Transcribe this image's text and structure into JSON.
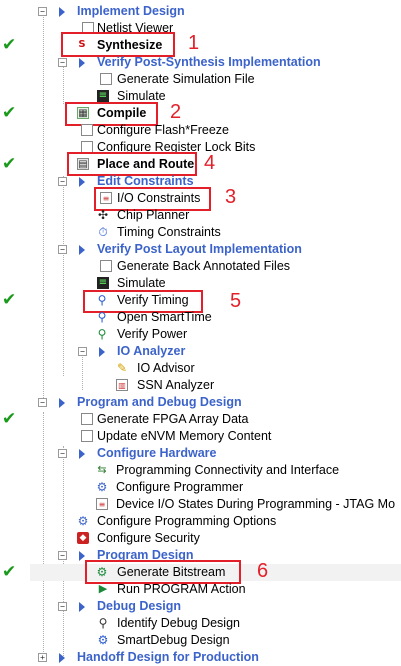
{
  "tree": {
    "implement_design": "Implement Design",
    "netlist_viewer": "Netlist Viewer",
    "synthesize": "Synthesize",
    "verify_post_synthesis": "Verify Post-Synthesis Implementation",
    "generate_simulation_file": "Generate Simulation File",
    "simulate_1": "Simulate",
    "compile": "Compile",
    "configure_flash_freeze": "Configure Flash*Freeze",
    "configure_register_lock_bits": "Configure Register Lock Bits",
    "place_and_route": "Place and Route",
    "edit_constraints": "Edit Constraints",
    "io_constraints": "I/O Constraints",
    "chip_planner": "Chip Planner",
    "timing_constraints": "Timing Constraints",
    "verify_post_layout": "Verify Post Layout Implementation",
    "generate_back_annotated": "Generate Back Annotated Files",
    "simulate_2": "Simulate",
    "verify_timing": "Verify Timing",
    "open_smarttime": "Open SmartTime",
    "verify_power": "Verify Power",
    "io_analyzer": "IO Analyzer",
    "io_advisor": "IO Advisor",
    "ssn_analyzer": "SSN Analyzer",
    "program_and_debug": "Program and Debug Design",
    "generate_fpga_array_data": "Generate FPGA Array Data",
    "update_envm": "Update eNVM Memory Content",
    "configure_hardware": "Configure Hardware",
    "programming_connectivity": "Programming Connectivity and Interface",
    "configure_programmer": "Configure Programmer",
    "device_io_states": "Device I/O States During Programming - JTAG Mo",
    "configure_programming_options": "Configure Programming Options",
    "configure_security": "Configure Security",
    "program_design": "Program Design",
    "generate_bitstream": "Generate Bitstream",
    "run_program_action": "Run PROGRAM Action",
    "debug_design": "Debug Design",
    "identify_debug_design": "Identify Debug Design",
    "smartdebug_design": "SmartDebug Design",
    "handoff_design": "Handoff Design for Production"
  },
  "annotations": {
    "n1": "1",
    "n2": "2",
    "n3": "3",
    "n4": "4",
    "n5": "5",
    "n6": "6"
  },
  "status": {
    "complete_mark": "✔"
  },
  "colors": {
    "accent_blue": "#3b63c9",
    "check_green": "#1a9a1a",
    "highlight_red": "#e3202a"
  }
}
